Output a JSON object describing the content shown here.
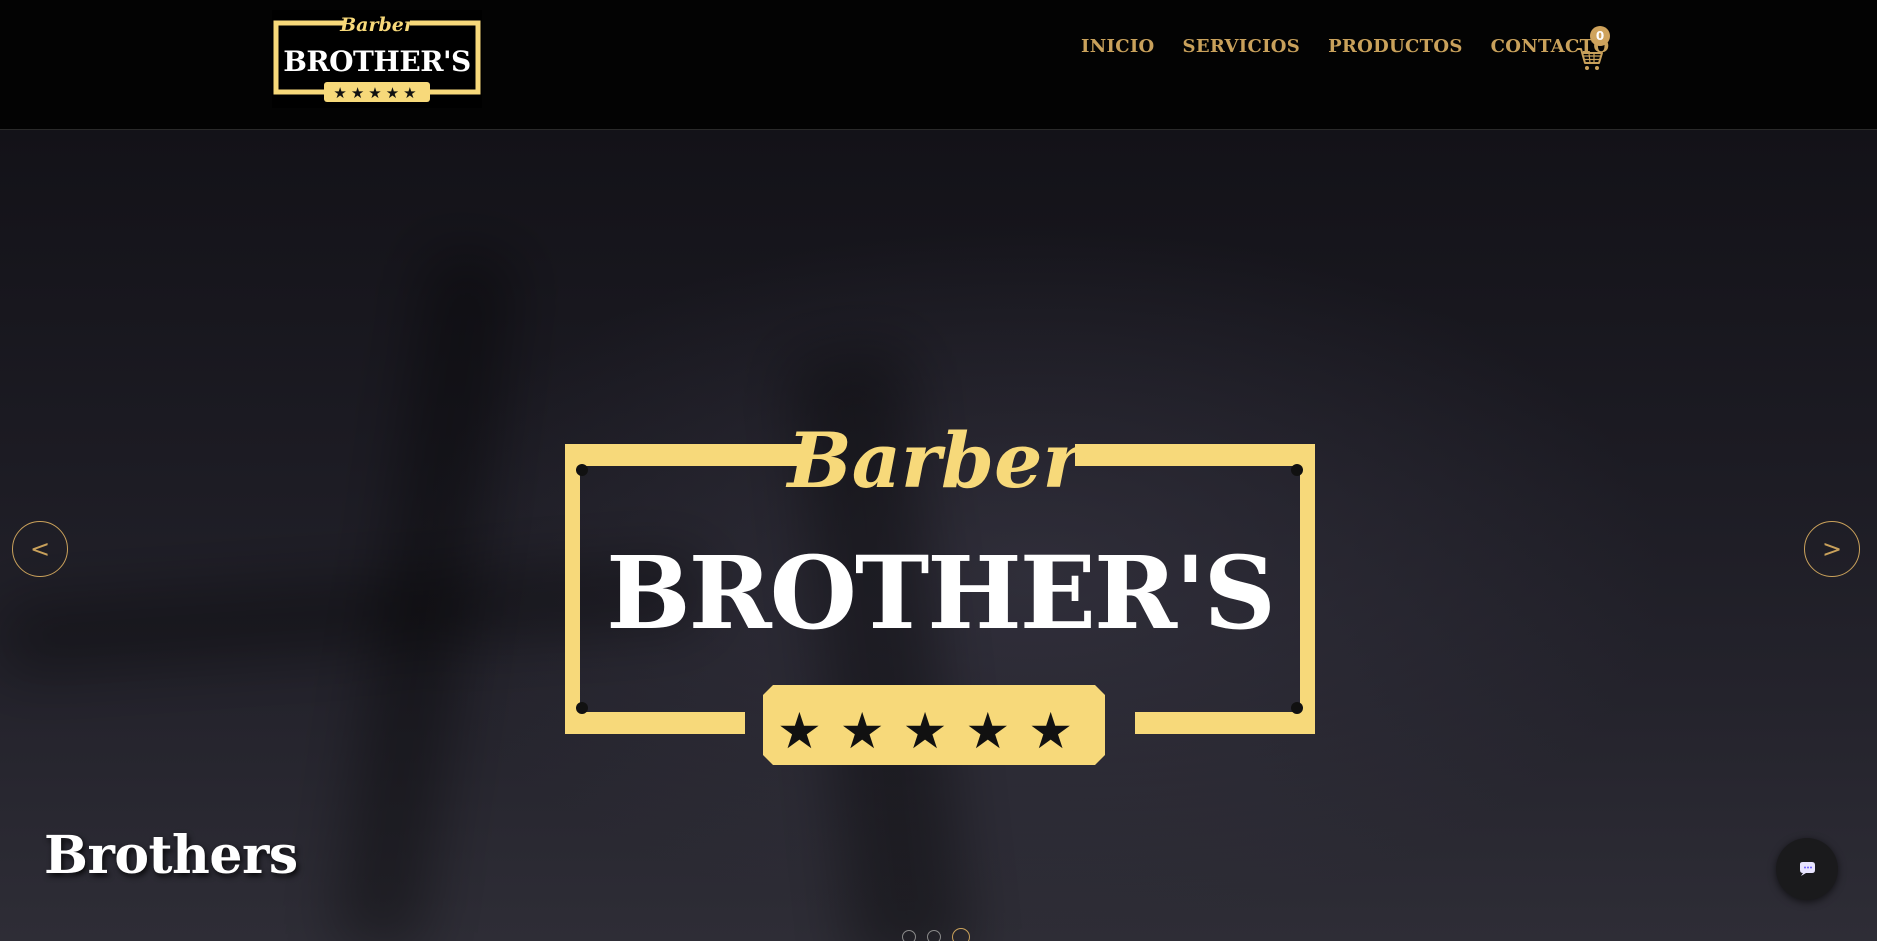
{
  "brand": {
    "script_word": "Barber",
    "main_word": "BROTHER'S",
    "stars": 5
  },
  "nav": {
    "items": [
      {
        "label": "INICIO"
      },
      {
        "label": "SERVICIOS"
      },
      {
        "label": "PRODUCTOS"
      },
      {
        "label": "CONTACTO"
      }
    ],
    "cart_count": "0"
  },
  "hero": {
    "caption": "Brothers",
    "prev_label": "<",
    "next_label": ">",
    "slides_total": 3,
    "active_slide": 3
  },
  "colors": {
    "gold": "#c9a15b",
    "logo_gold": "#f7d97a",
    "header_bg": "#030303"
  },
  "icons": {
    "cart": "shopping-cart-icon",
    "chat": "chat-bubble-icon"
  }
}
